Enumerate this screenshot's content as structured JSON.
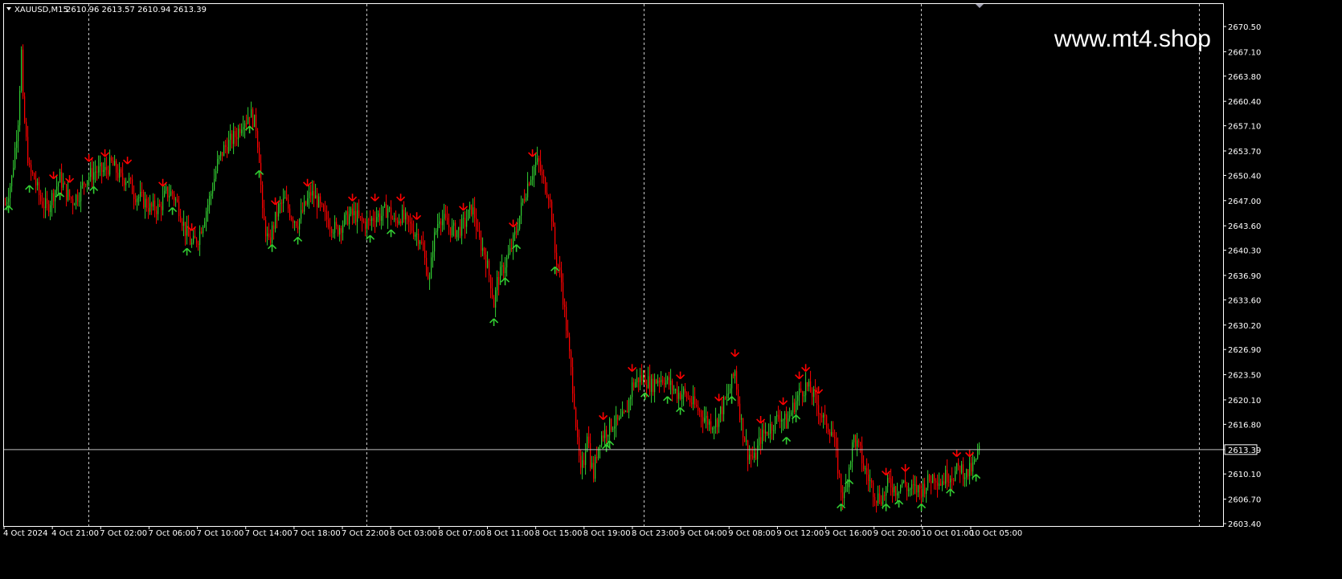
{
  "header": {
    "symbol": "XAUUSD,M15",
    "ohlc": "2610.96 2613.57 2610.94 2613.39"
  },
  "watermark": "www.mt4.shop",
  "colors": {
    "background": "#000000",
    "bull": "#32CD32",
    "bear": "#FF0000",
    "grid": "#C8C8C8",
    "axis": "#FFFFFF",
    "buy_arrow": "#32CD32",
    "sell_arrow": "#FF0000"
  },
  "chart_data": {
    "type": "candlestick",
    "symbol": "XAUUSD",
    "timeframe": "M15",
    "y_ticks": [
      "2670.50",
      "2667.10",
      "2663.80",
      "2660.40",
      "2657.10",
      "2653.70",
      "2650.40",
      "2647.00",
      "2643.60",
      "2640.30",
      "2636.90",
      "2633.60",
      "2630.20",
      "2626.90",
      "2623.50",
      "2620.10",
      "2616.80",
      "2613.39",
      "2610.10",
      "2606.70",
      "2603.40"
    ],
    "ylim": [
      2603.4,
      2670.5
    ],
    "x_ticks": [
      "4 Oct 2024",
      "4 Oct 21:00",
      "7 Oct 02:00",
      "7 Oct 06:00",
      "7 Oct 10:00",
      "7 Oct 14:00",
      "7 Oct 18:00",
      "7 Oct 22:00",
      "8 Oct 03:00",
      "8 Oct 07:00",
      "8 Oct 11:00",
      "8 Oct 15:00",
      "8 Oct 19:00",
      "8 Oct 23:00",
      "9 Oct 04:00",
      "9 Oct 08:00",
      "9 Oct 12:00",
      "9 Oct 16:00",
      "9 Oct 20:00",
      "10 Oct 01:00",
      "10 Oct 05:00"
    ],
    "current_price": 2613.39,
    "price_path": [
      [
        0,
        2646.5
      ],
      [
        4,
        2650
      ],
      [
        8,
        2658
      ],
      [
        10,
        2667
      ],
      [
        11,
        2660
      ],
      [
        13,
        2655
      ],
      [
        15,
        2651
      ],
      [
        18,
        2650
      ],
      [
        22,
        2647
      ],
      [
        26,
        2646
      ],
      [
        30,
        2648
      ],
      [
        34,
        2650
      ],
      [
        38,
        2648
      ],
      [
        42,
        2647
      ],
      [
        46,
        2648
      ],
      [
        50,
        2650
      ],
      [
        56,
        2651
      ],
      [
        62,
        2651
      ],
      [
        66,
        2652
      ],
      [
        72,
        2650
      ],
      [
        76,
        2650
      ],
      [
        80,
        2648
      ],
      [
        86,
        2647
      ],
      [
        90,
        2646
      ],
      [
        96,
        2646
      ],
      [
        100,
        2648
      ],
      [
        104,
        2648
      ],
      [
        108,
        2646
      ],
      [
        112,
        2643
      ],
      [
        116,
        2641
      ],
      [
        120,
        2642
      ],
      [
        124,
        2645
      ],
      [
        128,
        2648
      ],
      [
        132,
        2652
      ],
      [
        136,
        2654
      ],
      [
        140,
        2655
      ],
      [
        144,
        2656
      ],
      [
        148,
        2658
      ],
      [
        150,
        2658
      ],
      [
        152,
        2659
      ],
      [
        156,
        2657
      ],
      [
        158,
        2653
      ],
      [
        160,
        2645
      ],
      [
        164,
        2641
      ],
      [
        166,
        2643
      ],
      [
        170,
        2646
      ],
      [
        174,
        2647
      ],
      [
        178,
        2645
      ],
      [
        182,
        2644
      ],
      [
        186,
        2646
      ],
      [
        190,
        2648
      ],
      [
        194,
        2647
      ],
      [
        198,
        2645
      ],
      [
        202,
        2644
      ],
      [
        206,
        2643
      ],
      [
        210,
        2644
      ],
      [
        214,
        2645
      ],
      [
        218,
        2645
      ],
      [
        222,
        2644
      ],
      [
        226,
        2644
      ],
      [
        230,
        2645
      ],
      [
        234,
        2645
      ],
      [
        238,
        2646
      ],
      [
        242,
        2644
      ],
      [
        246,
        2645
      ],
      [
        250,
        2644
      ],
      [
        254,
        2643
      ],
      [
        258,
        2642
      ],
      [
        262,
        2638
      ],
      [
        264,
        2636
      ],
      [
        266,
        2641
      ],
      [
        270,
        2645
      ],
      [
        274,
        2644
      ],
      [
        278,
        2643
      ],
      [
        282,
        2643
      ],
      [
        286,
        2644
      ],
      [
        290,
        2646
      ],
      [
        292,
        2645
      ],
      [
        294,
        2642
      ],
      [
        298,
        2640
      ],
      [
        302,
        2636
      ],
      [
        304,
        2633
      ],
      [
        306,
        2636
      ],
      [
        310,
        2638
      ],
      [
        314,
        2640
      ],
      [
        318,
        2643
      ],
      [
        322,
        2647
      ],
      [
        326,
        2650
      ],
      [
        330,
        2652
      ],
      [
        332,
        2652
      ],
      [
        334,
        2650
      ],
      [
        338,
        2648
      ],
      [
        340,
        2645
      ],
      [
        342,
        2640
      ],
      [
        346,
        2636
      ],
      [
        348,
        2632
      ],
      [
        350,
        2628
      ],
      [
        352,
        2624
      ],
      [
        354,
        2620
      ],
      [
        356,
        2614
      ],
      [
        358,
        2610
      ],
      [
        360,
        2612
      ],
      [
        362,
        2616
      ],
      [
        364,
        2612
      ],
      [
        366,
        2610
      ],
      [
        368,
        2613
      ],
      [
        370,
        2615
      ],
      [
        374,
        2616
      ],
      [
        378,
        2617
      ],
      [
        382,
        2617
      ],
      [
        386,
        2618
      ],
      [
        390,
        2622
      ],
      [
        394,
        2623
      ],
      [
        398,
        2623
      ],
      [
        402,
        2622
      ],
      [
        406,
        2623
      ],
      [
        410,
        2623
      ],
      [
        414,
        2622
      ],
      [
        418,
        2621
      ],
      [
        422,
        2621
      ],
      [
        426,
        2620
      ],
      [
        430,
        2619
      ],
      [
        434,
        2618
      ],
      [
        438,
        2617
      ],
      [
        442,
        2617
      ],
      [
        446,
        2619
      ],
      [
        450,
        2621
      ],
      [
        454,
        2624
      ],
      [
        456,
        2620
      ],
      [
        458,
        2617
      ],
      [
        462,
        2613
      ],
      [
        466,
        2612
      ],
      [
        470,
        2615
      ],
      [
        474,
        2616
      ],
      [
        478,
        2617
      ],
      [
        482,
        2618
      ],
      [
        486,
        2617
      ],
      [
        490,
        2619
      ],
      [
        494,
        2621
      ],
      [
        498,
        2622
      ],
      [
        502,
        2621
      ],
      [
        506,
        2619
      ],
      [
        510,
        2617
      ],
      [
        514,
        2616
      ],
      [
        516,
        2614
      ],
      [
        518,
        2611
      ],
      [
        520,
        2608
      ],
      [
        522,
        2607
      ],
      [
        524,
        2610
      ],
      [
        528,
        2615
      ],
      [
        532,
        2613
      ],
      [
        534,
        2611
      ],
      [
        538,
        2609
      ],
      [
        542,
        2607
      ],
      [
        546,
        2607
      ],
      [
        550,
        2609
      ],
      [
        554,
        2608
      ],
      [
        558,
        2609
      ],
      [
        562,
        2608
      ],
      [
        566,
        2608
      ],
      [
        570,
        2608
      ],
      [
        574,
        2609
      ],
      [
        578,
        2610
      ],
      [
        582,
        2609
      ],
      [
        586,
        2610
      ],
      [
        590,
        2610
      ],
      [
        594,
        2611
      ],
      [
        598,
        2610
      ],
      [
        602,
        2611
      ],
      [
        604,
        2612
      ],
      [
        606,
        2613.4
      ]
    ],
    "buy_signal_bars": [
      2,
      15,
      34,
      55,
      104,
      113,
      152,
      158,
      166,
      182,
      227,
      240,
      304,
      311,
      318,
      342,
      374,
      376,
      398,
      412,
      420,
      452,
      486,
      492,
      520,
      525,
      548,
      556,
      570,
      588,
      604
    ],
    "sell_signal_bars": [
      30,
      40,
      52,
      62,
      76,
      98,
      116,
      168,
      188,
      216,
      230,
      246,
      256,
      285,
      316,
      328,
      372,
      390,
      420,
      444,
      454,
      470,
      484,
      494,
      498,
      506,
      548,
      560,
      592,
      600
    ]
  }
}
